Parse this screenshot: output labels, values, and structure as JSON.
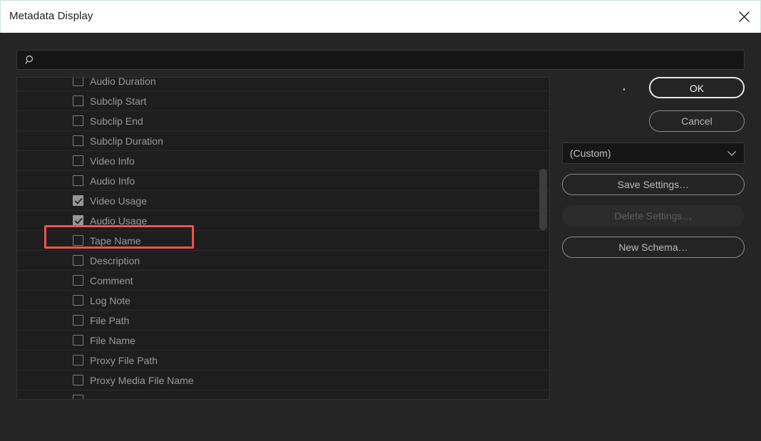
{
  "window": {
    "title": "Metadata Display",
    "close_icon": "close-icon"
  },
  "search": {
    "value": "",
    "placeholder": "",
    "icon": "search-icon"
  },
  "list": {
    "items": [
      {
        "label": "Audio Duration",
        "checked": false
      },
      {
        "label": "Subclip Start",
        "checked": false
      },
      {
        "label": "Subclip End",
        "checked": false
      },
      {
        "label": "Subclip Duration",
        "checked": false
      },
      {
        "label": "Video Info",
        "checked": false
      },
      {
        "label": "Audio Info",
        "checked": false
      },
      {
        "label": "Video Usage",
        "checked": true
      },
      {
        "label": "Audio Usage",
        "checked": true
      },
      {
        "label": "Tape Name",
        "checked": false
      },
      {
        "label": "Description",
        "checked": false
      },
      {
        "label": "Comment",
        "checked": false
      },
      {
        "label": "Log Note",
        "checked": false
      },
      {
        "label": "File Path",
        "checked": false
      },
      {
        "label": "File Name",
        "checked": false
      },
      {
        "label": "Proxy File Path",
        "checked": false
      },
      {
        "label": "Proxy Media File Name",
        "checked": false
      },
      {
        "label": "",
        "checked": false
      }
    ]
  },
  "sidebar": {
    "ok_label": "OK",
    "cancel_label": "Cancel",
    "preset_value": "(Custom)",
    "preset_chevron_icon": "chevron-down-icon",
    "save_settings_label": "Save Settings…",
    "delete_settings_label": "Delete Settings…",
    "new_schema_label": "New Schema…"
  },
  "annotation": {
    "highlight_target": "Video Usage",
    "highlight_color": "#f4524d"
  },
  "colors": {
    "titlebar_bg": "#ffffff",
    "dialog_bg": "#252525",
    "list_bg": "#1e1e1e",
    "field_bg": "#161616",
    "text": "#9a9a9a",
    "accent_focus": "#e6e6e6"
  }
}
